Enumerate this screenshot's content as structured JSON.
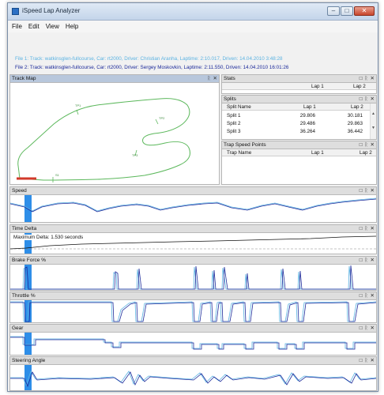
{
  "window": {
    "title": "iSpeed Lap Analyzer",
    "controls": {
      "minimize": "–",
      "maximize": "□",
      "close": "✕"
    }
  },
  "menu": [
    "File",
    "Edit",
    "View",
    "Help"
  ],
  "files": {
    "file1": "File 1: Track: watkinsglen-fullcourse, Car: rt2000, Driver: Christian Aranha, Laptime: 2:10.017, Driven: 14.04.2010 3:48:28",
    "file2": "File 2: Track: watkinsglen-fullcourse, Car: rt2000, Driver: Sergey Moskovkin, Laptime: 2:11.550, Driven: 14.04.2010 16:01:26"
  },
  "panel_buttons": {
    "pin": "□",
    "float": "ᚱ",
    "close": "✕"
  },
  "track_map": {
    "title": "Track Map",
    "labels": [
      "TP1",
      "TP2",
      "TP3",
      "S1"
    ]
  },
  "stats": {
    "title": "Stats",
    "col1": "Lap 1",
    "col2": "Lap 2"
  },
  "splits": {
    "title": "Splits",
    "headers": [
      "Split Name",
      "Lap 1",
      "Lap 2"
    ],
    "rows": [
      [
        "Split 1",
        "29.806",
        "30.181"
      ],
      [
        "Split 2",
        "29.486",
        "29.863"
      ],
      [
        "Split 3",
        "36.264",
        "36.442"
      ]
    ]
  },
  "trap": {
    "title": "Trap Speed Points",
    "headers": [
      "Trap Name",
      "Lap 1",
      "Lap 2"
    ]
  },
  "channels": {
    "speed": {
      "title": "Speed"
    },
    "delta": {
      "title": "Time Delta",
      "annotation": "Maximum Delta: 1.530 seconds"
    },
    "brake": {
      "title": "Brake Force %"
    },
    "throttle": {
      "title": "Throttle %"
    },
    "gear": {
      "title": "Gear"
    },
    "steer": {
      "title": "Steering Angle"
    }
  },
  "colors": {
    "lap1": "#5cb3e2",
    "lap2": "#1c2a9a",
    "cursor": "#2e8ee8",
    "track": "#5cb85c",
    "track_marker": "#d23a2a"
  }
}
